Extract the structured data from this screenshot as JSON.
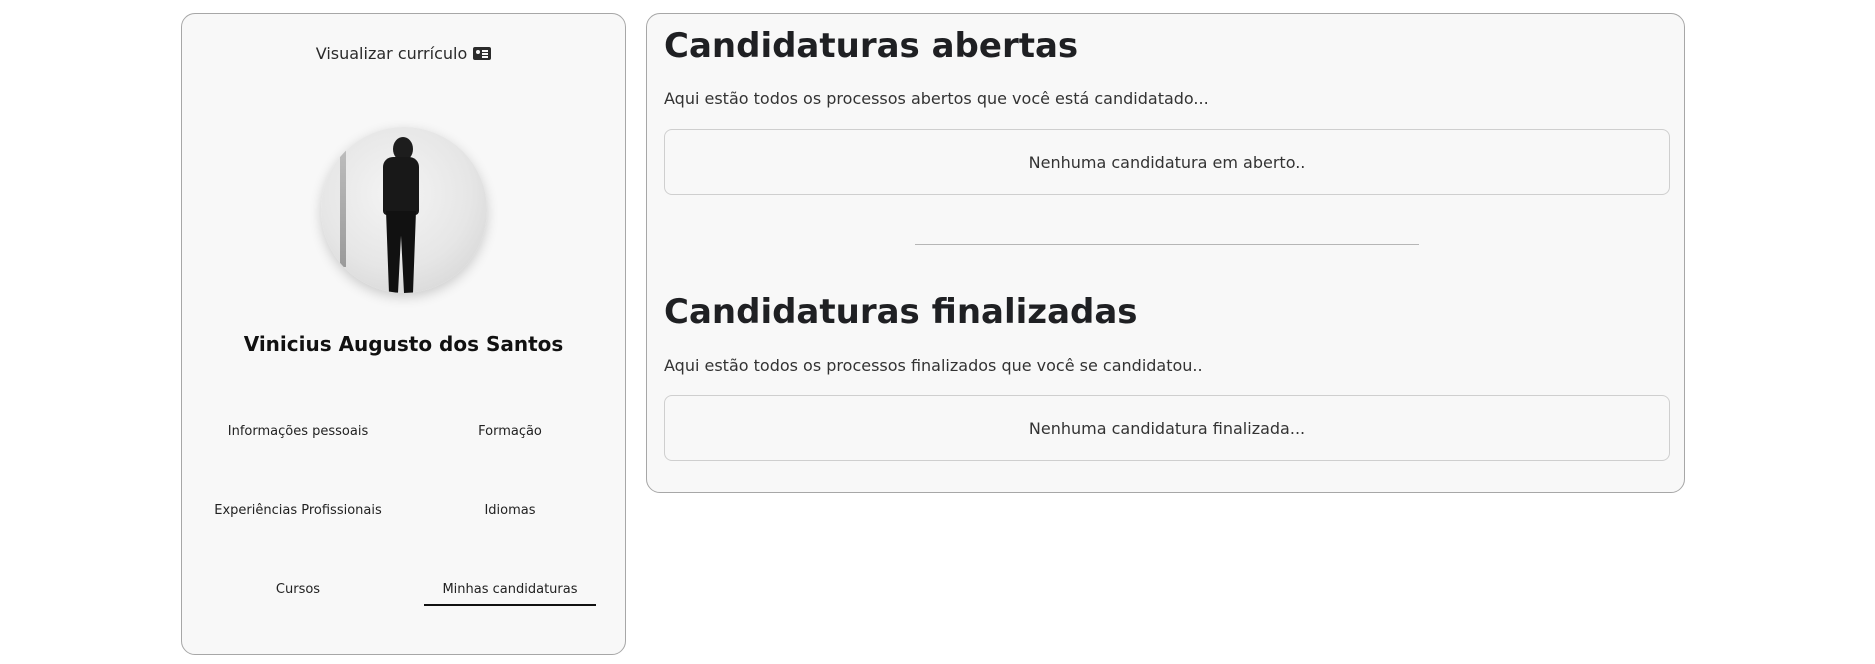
{
  "profile": {
    "view_cv_label": "Visualizar currículo",
    "view_cv_icon": "id-card-icon",
    "name": "Vinicius Augusto dos Santos",
    "nav": [
      {
        "label": "Informações pessoais"
      },
      {
        "label": "Formação"
      },
      {
        "label": "Experiências Profissionais"
      },
      {
        "label": "Idiomas"
      },
      {
        "label": "Cursos"
      },
      {
        "label": "Minhas candidaturas",
        "active": true
      }
    ]
  },
  "open_applications": {
    "title": "Candidaturas abertas",
    "description": "Aqui estão todos os processos abertos que você está candidatado...",
    "empty_text": "Nenhuma candidatura em aberto.."
  },
  "finished_applications": {
    "title": "Candidaturas finalizadas",
    "description": "Aqui estão todos os processos finalizados que você se candidatou..",
    "empty_text": "Nenhuma candidatura finalizada..."
  },
  "colors": {
    "card_background": "#f8f8f8",
    "border": "#a7a7a7",
    "active_underline": "#111111"
  }
}
